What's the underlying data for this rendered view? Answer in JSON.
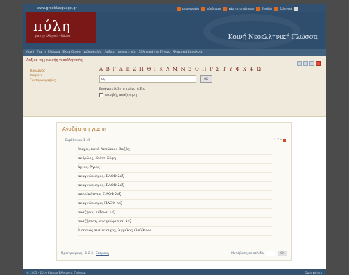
{
  "header": {
    "tagline": "www.greeklanguage.gr",
    "logo_text": "πύλη",
    "logo_sub": "για την ελληνική γλώσσα",
    "dict_title": "Κοινή Νεοελληνική Γλώσσα",
    "top_links": [
      "επικοινωνία",
      "σύνδεσμοι",
      "χάρτης ιστότοπου",
      "English",
      "Ελληνικά"
    ]
  },
  "nav": {
    "items": [
      "Αρχή",
      "Για τη Γλώσσα",
      "Εκπαίδευση",
      "Διδασκαλία",
      "Λεξικά",
      "Λογοτεχνία",
      "Ελληνικά για ξένους",
      "Ψηφιακά Εργαλεία"
    ]
  },
  "search": {
    "breadcrumb": "Λεξικό της κοινής νεοελληνικής",
    "side_links": [
      "Πρόλογος",
      "Οδηγίες",
      "Συντομογραφίες"
    ],
    "alphabet": "Α Β Γ Δ Ε Ζ Η Θ Ι Κ Λ Μ Ν Ξ Ο Π Ρ Σ Τ Υ Φ Χ Ψ Ω",
    "input_value": "ος",
    "button_label": "OK",
    "hint": "Εισάγετε λέξη ή τμήμα λέξης",
    "checkbox_label": "ακριβής αναζήτηση"
  },
  "results": {
    "title": "Αναζήτηση για:",
    "query": "ος",
    "count": "Ευρέθηκαν 1-15",
    "pager": "1 2 »",
    "items": [
      "βρέχω, κατά Αντώνιος Βαζάς",
      "ανδρώος, Κιάτη Σόφη",
      "άγιος, Άγιος",
      "αναγνώρισμος, ΒΛΟΦ λεξ",
      "αναγνωρισμός, ΒΛΟΦ λεξ",
      "απλοϊκότητα, ΠΛΟΦ λεξ",
      "αναγνώρισμα, ΠΛΟΦ λεξ",
      "αναζητώ, λέξεων λεξ",
      "αναζήτηση, αναγνώρισμα, λεξ",
      "βιοποιός αντίστοιχος, Άγγελος ελεύθερος"
    ],
    "footer_left": "Προηγούμενη",
    "footer_pages": "1 2 3",
    "footer_next": "Επόμενη",
    "goto_label": "Μετάβαση σε σελίδα",
    "goto_button": "OK"
  },
  "footer": {
    "left": "© 2005 - 2010 Κέντρο Ελληνικής Γλώσσας",
    "right": "Όροι χρήσης"
  }
}
